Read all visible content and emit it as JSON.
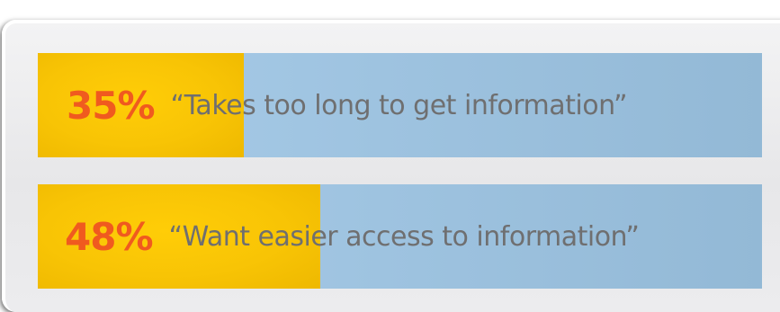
{
  "chart_data": {
    "type": "bar",
    "orientation": "horizontal",
    "categories": [
      "“Takes too long to get information”",
      "“Want easier access to information”"
    ],
    "values": [
      35,
      48
    ],
    "value_labels": [
      "35%",
      "48%"
    ],
    "xlim": [
      0,
      123
    ],
    "title": "",
    "xlabel": "",
    "ylabel": "",
    "grid": false,
    "legend": "none"
  },
  "colors": {
    "fill": "#f8c405",
    "track": "#9cc3e1",
    "percent_text": "#f05a1f",
    "quote_text": "#6f6f70"
  }
}
